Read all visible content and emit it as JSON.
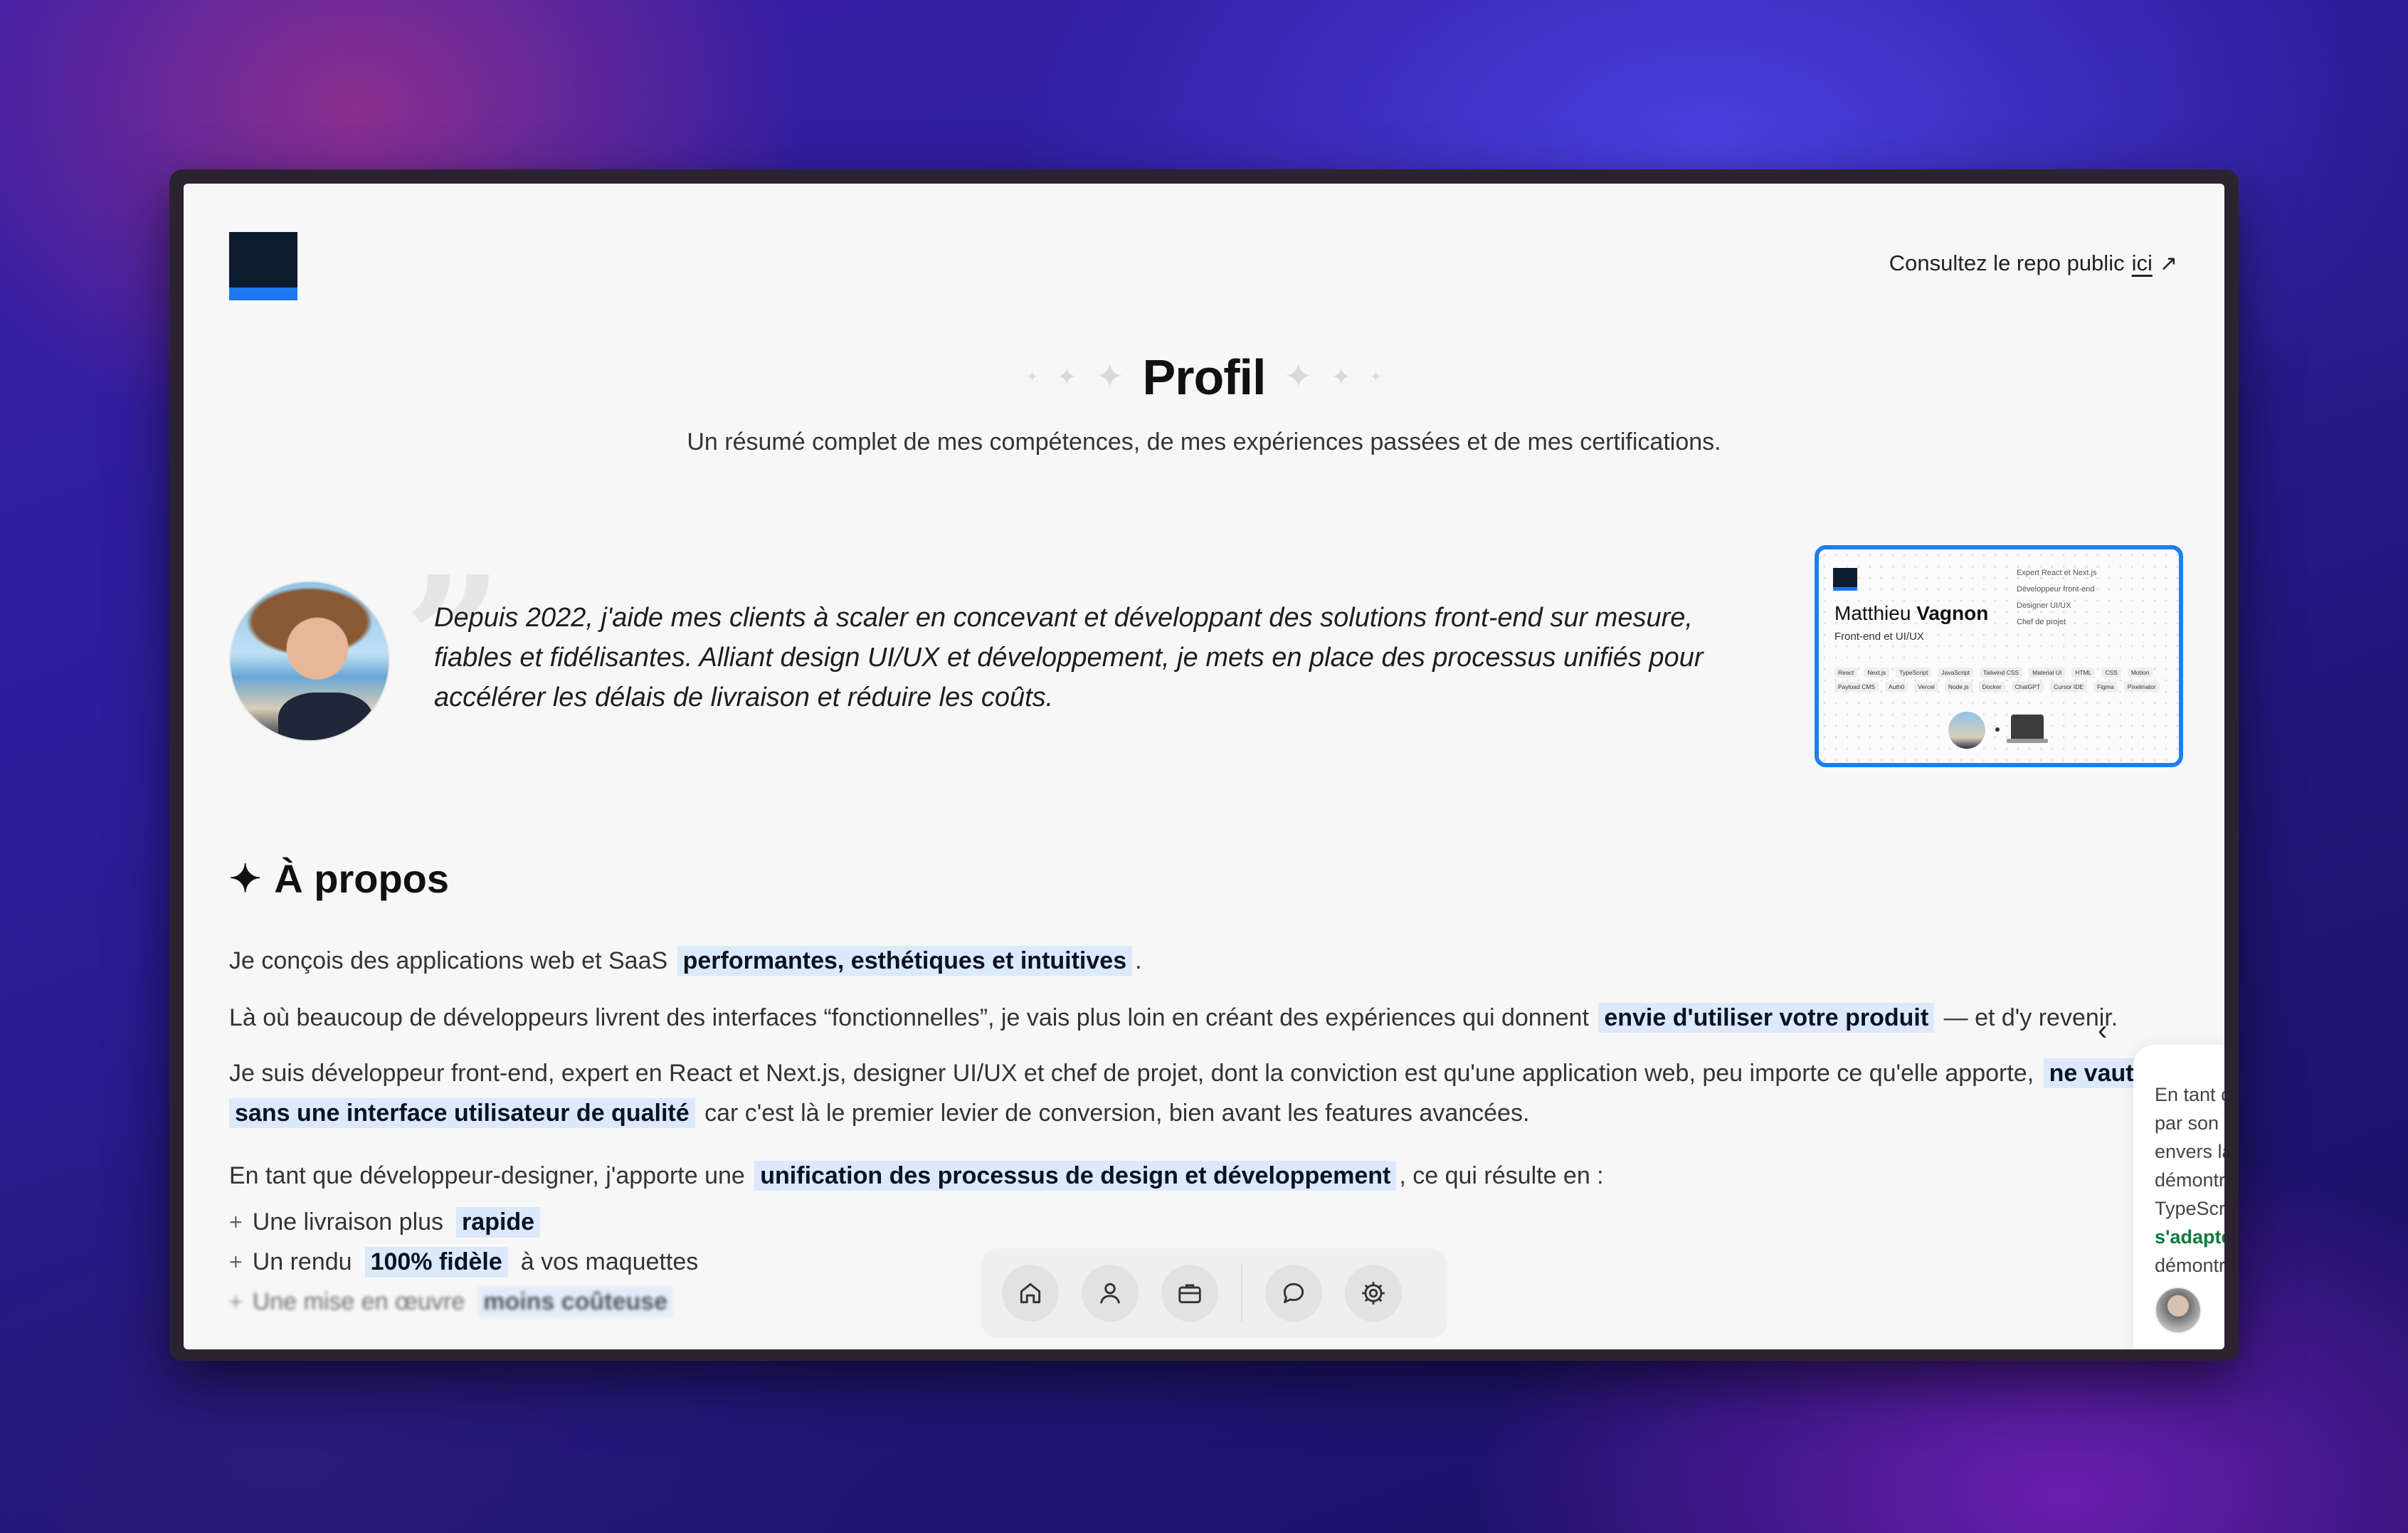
{
  "header": {
    "repo_text": "Consultez le repo public",
    "repo_link": "ici",
    "repo_arrow": "↗"
  },
  "page": {
    "title": "Profil",
    "subtitle": "Un résumé complet de mes compétences, de mes expériences passées et de mes certifications."
  },
  "intro": {
    "quote_mark": "”",
    "quote": "Depuis 2022, j'aide mes clients à scaler en concevant et développant des solutions front-end sur mesure, fiables et fidélisantes. Alliant design UI/UX et développement, je mets en place des processus unifiés pour accélérer les délais de livraison et réduire les coûts."
  },
  "card": {
    "first_name": "Matthieu",
    "last_name": "Vagnon",
    "role": "Front-end et UI/UX",
    "titles": [
      "Expert React et Next.js",
      "Développeur front-end",
      "Designer UI/UX",
      "Chef de projet"
    ],
    "tags": [
      "React",
      "Next.js",
      "TypeScript",
      "JavaScript",
      "Tailwind CSS",
      "Material UI",
      "HTML",
      "CSS",
      "Motion",
      "Payload CMS",
      "Auth0",
      "Vercel",
      "Node.js",
      "Docker",
      "ChatGPT",
      "Cursor IDE",
      "Figma",
      "Pixelmator"
    ]
  },
  "about": {
    "heading": "À propos",
    "p1_before": "Je conçois des applications web et SaaS",
    "p1_hl": "performantes, esthétiques et intuitives",
    "p1_after": ".",
    "p2_before": "Là où beaucoup de développeurs livrent des interfaces “fonctionnelles”, je vais plus loin en créant des expériences qui donnent",
    "p2_hl": "envie d'utiliser votre produit",
    "p2_after": "— et d'y revenir.",
    "p3_before": "Je suis développeur front-end, expert en React et Next.js, designer UI/UX et chef de projet, dont la conviction est qu'une application web, peu importe ce qu'elle apporte,",
    "p3_hl1": "ne vaut r",
    "p3_hl2": "sans une interface utilisateur de qualité",
    "p3_after": "car c'est là le premier levier de conversion, bien avant les features avancées.",
    "p4_before": "En tant que développeur-designer, j'apporte une",
    "p4_hl": "unification des processus de design et développement",
    "p4_after": ", ce qui résulte en :",
    "list": [
      {
        "before": "Une livraison plus",
        "hl": "rapide",
        "after": ""
      },
      {
        "before": "Un rendu",
        "hl": "100% fidèle",
        "after": "à vos maquettes"
      },
      {
        "before": "Une mise en œuvre",
        "hl": "moins coûteuse",
        "after": ""
      }
    ]
  },
  "testimonial": {
    "lines": [
      "En tant c",
      "par son",
      "envers la",
      "démontr",
      "TypeScr"
    ],
    "green": "s'adapte",
    "last": "démontr"
  },
  "dock": {
    "items": [
      "home-icon",
      "profile-icon",
      "briefcase-icon",
      "chat-icon",
      "settings-icon"
    ]
  },
  "colors": {
    "accent": "#1b78f2",
    "highlight": "#dbe9fb",
    "logo": "#0d1b2e"
  }
}
